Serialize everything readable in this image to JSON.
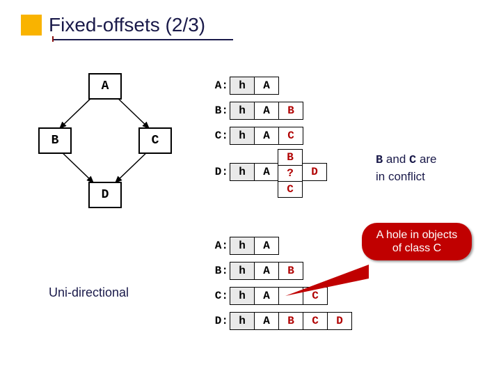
{
  "title": "Fixed-offsets (2/3)",
  "graph": {
    "nodes": {
      "a": "A",
      "b": "B",
      "c": "C",
      "d": "D"
    }
  },
  "top_tables": {
    "A": [
      "h",
      "A"
    ],
    "B": [
      "h",
      "A",
      "B"
    ],
    "C": [
      "h",
      "A",
      "C"
    ],
    "D_left": [
      "h",
      "A"
    ],
    "D_right": "D",
    "D_stack": [
      "B",
      "?",
      "C"
    ]
  },
  "bottom_tables": {
    "A": [
      "h",
      "A"
    ],
    "B": [
      "h",
      "A",
      "B"
    ],
    "C": [
      "h",
      "A",
      "",
      "C"
    ],
    "D": [
      "h",
      "A",
      "B",
      "C",
      "D"
    ]
  },
  "caption": "Uni-directional",
  "conflict_note_1a": "B",
  "conflict_note_1b": " and ",
  "conflict_note_1c": "C",
  "conflict_note_1d": " are",
  "conflict_note_2": "in conflict",
  "callout": "A hole in objects of class C"
}
